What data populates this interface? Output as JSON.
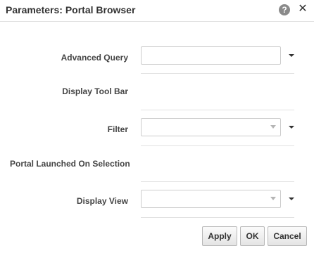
{
  "dialog": {
    "title": "Parameters: Portal Browser",
    "help_icon": "?",
    "close_icon": "✕"
  },
  "fields": [
    {
      "label": "Advanced Query",
      "control": "text",
      "value": ""
    },
    {
      "label": "Display Tool Bar",
      "control": "none"
    },
    {
      "label": "Filter",
      "control": "select",
      "value": ""
    },
    {
      "label": "Portal Launched On Selection",
      "control": "none"
    },
    {
      "label": "Display View",
      "control": "select",
      "value": ""
    }
  ],
  "buttons": {
    "apply": "Apply",
    "ok": "OK",
    "cancel": "Cancel"
  },
  "icons": {
    "help": "help-icon",
    "close": "close-icon",
    "dropdown": "chevron-down-icon",
    "menu": "caret-down-icon"
  },
  "colors": {
    "help_icon_bg": "#8a8a8a",
    "border": "#cccccc",
    "separator": "#e2e2e2"
  }
}
